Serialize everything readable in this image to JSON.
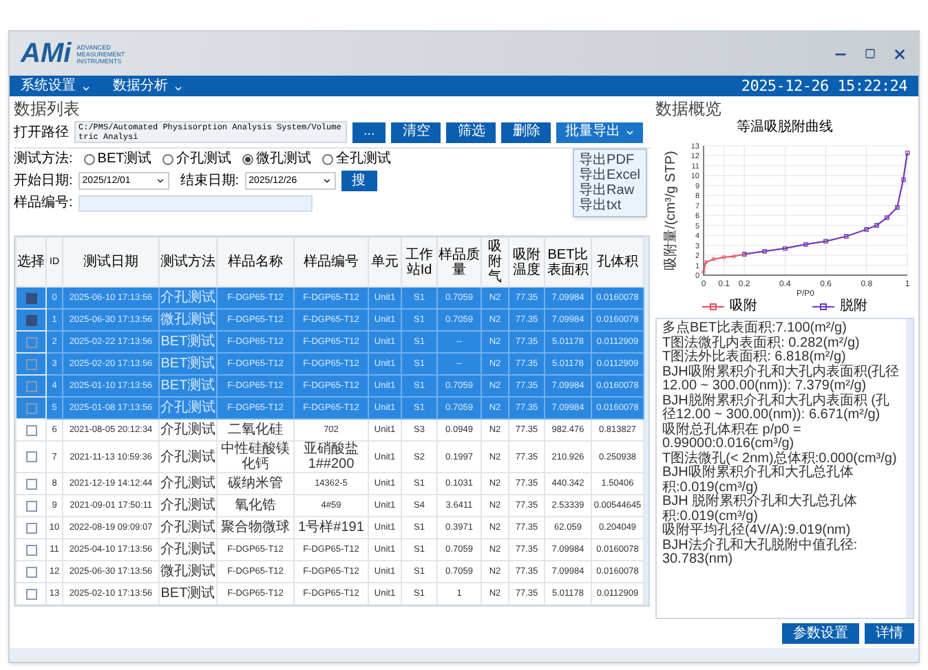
{
  "logo": {
    "mark": "AMi",
    "tagline": [
      "ADVANCED",
      "MEASUREMENT",
      "INSTRUMENTS"
    ]
  },
  "menu": [
    {
      "label": "系统设置"
    },
    {
      "label": "数据分析"
    }
  ],
  "clock": "2025-12-26 15:22:24",
  "list_panel": {
    "title": "数据列表",
    "path": {
      "label": "打开路径",
      "value": "C:/PMS/Automated Physisorption Analysis System/Volumetric Analysi"
    },
    "buttons": [
      "...",
      "清空",
      "筛选",
      "删除"
    ],
    "export": {
      "label": "批量导出",
      "expanded": true,
      "items": [
        "导出PDF",
        "导出Excel",
        "导出Raw",
        "导出txt"
      ]
    },
    "method": {
      "label": "测试方法:",
      "options": [
        {
          "label": "BET测试",
          "selected": false
        },
        {
          "label": "介孔测试",
          "selected": false
        },
        {
          "label": "微孔测试",
          "selected": true
        },
        {
          "label": "全孔测试",
          "selected": false
        }
      ]
    },
    "start": {
      "label": "开始日期:",
      "value": "2025/12/01"
    },
    "end": {
      "label": "结束日期:",
      "value": "2025/12/26"
    },
    "search": "搜",
    "sample": {
      "label": "样品编号:"
    },
    "table": {
      "select_header": "选择",
      "columns": [
        "ID",
        "测试日期",
        "测试方法",
        "样品名称",
        "样品编号",
        "单元",
        "工作站Id",
        "样品质量",
        "吸附气",
        "吸附温度",
        "BET比表面积",
        "孔体积"
      ],
      "rows": [
        {
          "selected": true,
          "checked": true,
          "cells": [
            "0",
            "2025-06-10 17:13:56",
            "介孔测试",
            "F-DGP65-T12",
            "F-DGP65-T12",
            "Unit1",
            "S1",
            "0.7059",
            "N2",
            "77.35",
            "7.09984",
            "0.0160078"
          ]
        },
        {
          "selected": true,
          "checked": true,
          "cells": [
            "1",
            "2025-06-30 17:13:56",
            "微孔测试",
            "F-DGP65-T12",
            "F-DGP65-T12",
            "Unit1",
            "S1",
            "0.7059",
            "N2",
            "77.35",
            "7.09984",
            "0.0160078"
          ]
        },
        {
          "selected": true,
          "checked": false,
          "cells": [
            "2",
            "2025-02-22 17:13:56",
            "BET测试",
            "F-DGP65-T12",
            "F-DGP65-T12",
            "Unit1",
            "S1",
            "--",
            "N2",
            "77.35",
            "5.01178",
            "0.0112909"
          ]
        },
        {
          "selected": true,
          "checked": false,
          "cells": [
            "3",
            "2025-02-20 17:13:56",
            "BET测试",
            "F-DGP65-T12",
            "F-DGP65-T12",
            "Unit1",
            "S1",
            "--",
            "N2",
            "77.35",
            "5.01178",
            "0.0112909"
          ]
        },
        {
          "selected": true,
          "checked": false,
          "cells": [
            "4",
            "2025-01-10 17:13:56",
            "BET测试",
            "F-DGP65-T12",
            "F-DGP65-T12",
            "Unit1",
            "S1",
            "0.7059",
            "N2",
            "77.35",
            "7.09984",
            "0.0160078"
          ]
        },
        {
          "selected": true,
          "checked": false,
          "cells": [
            "5",
            "2025-01-08 17:13:56",
            "介孔测试",
            "F-DGP65-T12",
            "F-DGP65-T12",
            "Unit1",
            "S1",
            "0.7059",
            "N2",
            "77.35",
            "7.09984",
            "0.0160078"
          ]
        },
        {
          "selected": false,
          "checked": false,
          "cells": [
            "6",
            "2021-08-05 20:12:34",
            "介孔测试",
            "二氧化硅",
            "702",
            "Unit1",
            "S3",
            "0.0949",
            "N2",
            "77.35",
            "982.476",
            "0.813827"
          ]
        },
        {
          "selected": false,
          "checked": false,
          "cells": [
            "7",
            "2021-11-13 10:59:36",
            "介孔测试",
            "中性硅酸镁化钙",
            "亚硝酸盐1##200",
            "Unit1",
            "S2",
            "0.1997",
            "N2",
            "77.35",
            "210.926",
            "0.250938"
          ]
        },
        {
          "selected": false,
          "checked": false,
          "cells": [
            "8",
            "2021-12-19 14:12:44",
            "介孔测试",
            "碳纳米管",
            "14362-5",
            "Unit1",
            "S1",
            "0.1031",
            "N2",
            "77.35",
            "440.342",
            "1.50406"
          ]
        },
        {
          "selected": false,
          "checked": false,
          "cells": [
            "9",
            "2021-09-01 17:50:11",
            "介孔测试",
            "氧化锆",
            "4#59",
            "Unit1",
            "S4",
            "3.6411",
            "N2",
            "77.35",
            "2.53339",
            "0.00544645"
          ]
        },
        {
          "selected": false,
          "checked": false,
          "cells": [
            "10",
            "2022-08-19 09:09:07",
            "介孔测试",
            "聚合物微球",
            "1号样#191",
            "Unit1",
            "S1",
            "0.3971",
            "N2",
            "77.35",
            "62.059",
            "0.204049"
          ]
        },
        {
          "selected": false,
          "checked": false,
          "cells": [
            "11",
            "2025-04-10 17:13:56",
            "介孔测试",
            "F-DGP65-T12",
            "F-DGP65-T12",
            "Unit1",
            "S1",
            "0.7059",
            "N2",
            "77.35",
            "7.09984",
            "0.0160078"
          ]
        },
        {
          "selected": false,
          "checked": false,
          "cells": [
            "12",
            "2025-06-30 17:13:56",
            "微孔测试",
            "F-DGP65-T12",
            "F-DGP65-T12",
            "Unit1",
            "S1",
            "0.7059",
            "N2",
            "77.35",
            "7.09984",
            "0.0160078"
          ]
        },
        {
          "selected": false,
          "checked": false,
          "cells": [
            "13",
            "2025-02-10 17:13:56",
            "BET测试",
            "F-DGP65-T12",
            "F-DGP65-T12",
            "Unit1",
            "S1",
            "1",
            "N2",
            "77.35",
            "5.01178",
            "0.0112909"
          ]
        }
      ]
    }
  },
  "overview": {
    "title": "数据概览",
    "chart_data": {
      "type": "line",
      "grid": true,
      "legend": "bottom",
      "title": "等温吸脱附曲线",
      "xlabel": "P/P0",
      "ylabel": "吸附量/(cm³/g STP)",
      "x": [
        0,
        0.01,
        0.05,
        0.1,
        0.15,
        0.2,
        0.3,
        0.4,
        0.5,
        0.6,
        0.7,
        0.8,
        0.85,
        0.9,
        0.95,
        0.98,
        1
      ],
      "series": [
        {
          "name": "吸附",
          "color": "#e05060",
          "values": [
            0.3,
            1.3,
            1.6,
            1.8,
            1.9,
            2.1,
            2.4,
            2.7,
            3.1,
            3.4,
            3.9,
            4.6,
            5.0,
            5.8,
            6.8,
            9.6,
            12.3
          ]
        },
        {
          "name": "脱附",
          "color": "#6a3fc8",
          "values": [
            null,
            null,
            null,
            null,
            null,
            2.1,
            2.4,
            2.7,
            3.1,
            3.4,
            3.9,
            4.6,
            5.0,
            5.8,
            6.8,
            9.6,
            12.3
          ]
        }
      ],
      "xlim": [
        0,
        1
      ],
      "ylim": [
        0,
        13
      ],
      "xticks": [
        0,
        0.1,
        0.2,
        0.4,
        0.6,
        0.8,
        1
      ],
      "yticks": [
        0,
        1,
        2,
        3,
        4,
        5,
        6,
        7,
        8,
        9,
        10,
        11,
        12,
        13
      ]
    },
    "results": [
      "多点BET比表面积:7.100(m²/g)",
      "T图法微孔内表面积: 0.282(m²/g)",
      "T图法外比表面积: 6.818(m²/g)",
      "BJH吸附累积介孔和大孔内表面积(孔径12.00 ~ 300.00(nm)): 7.379(m²/g)",
      "BJH脱附累积介孔和大孔内表面积 (孔径12.00 ~ 300.00(nm)): 6.671(m²/g)",
      "吸附总孔体积在 p/p0 = 0.99000:0.016(cm³/g)",
      "T图法微孔(< 2nm)总体积:0.000(cm³/g)",
      "BJH吸附累积介孔和大孔总孔体积:0.019(cm³/g)",
      "BJH 脱附累积介孔和大孔总孔体积:0.019(cm³/g)",
      "吸附平均孔径(4V/A):9.019(nm)",
      "BJH法介孔和大孔脱附中值孔径: 30.783(nm)"
    ],
    "buttons": [
      "参数设置",
      "详情"
    ]
  }
}
